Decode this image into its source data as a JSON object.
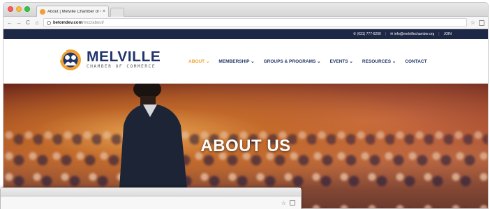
{
  "browser": {
    "tab_title": "About | Melville Chamber of C",
    "tab_close": "×",
    "back": "←",
    "forward": "→",
    "reload": "C",
    "home": "⌂",
    "url_host": "betomdev.com",
    "url_path": "/mcc/about/",
    "star": "☆"
  },
  "site": {
    "topbar": {
      "phone": "(631) 777-6260",
      "separator": "|",
      "email": "info@melvillechamber.org",
      "join": "JOIN"
    },
    "brand": {
      "name": "MELVILLE",
      "subtitle": "CHAMBER OF COMMERCE"
    },
    "nav": [
      {
        "label": "ABOUT ⌄"
      },
      {
        "label": "MEMBERSHIP ⌄"
      },
      {
        "label": "GROUPS & PROGRAMS ⌄"
      },
      {
        "label": "EVENTS ⌄"
      },
      {
        "label": "RESOURCES ⌄"
      },
      {
        "label": "CONTACT"
      }
    ],
    "hero_title": "ABOUT US"
  },
  "front_window": {
    "star": "☆"
  },
  "colors": {
    "navy": "#22356b",
    "topbar": "#1d2746",
    "accent_orange": "#f0a232"
  },
  "icons": [
    "info-icon",
    "star-icon",
    "extension-icon",
    "phone-icon",
    "mail-icon",
    "logo-icon"
  ]
}
